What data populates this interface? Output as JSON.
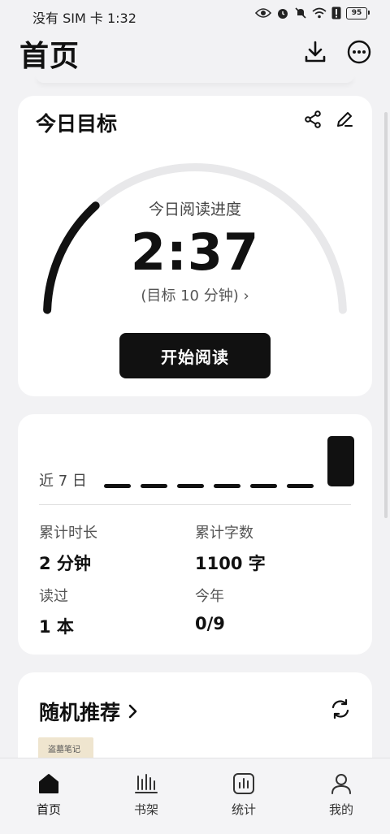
{
  "status_bar": {
    "left_text": "没有 SIM 卡 1:32",
    "battery": "95"
  },
  "header": {
    "title": "首页",
    "icons": [
      "download-icon",
      "more-icon"
    ]
  },
  "goal_card": {
    "title": "今日目标",
    "icons": [
      "share-icon",
      "edit-icon"
    ],
    "progress_label": "今日阅读进度",
    "time": "2:37",
    "target": "(目标 10 分钟) ›",
    "progress_fraction": 0.26,
    "start_button": "开始阅读"
  },
  "stats_card": {
    "recent_label": "近 7 日",
    "weekly_values": [
      0,
      0,
      0,
      0,
      0,
      0,
      1
    ],
    "stats": [
      {
        "label": "累计时长",
        "value": "2 分钟"
      },
      {
        "label": "累计字数",
        "value": "1100 字"
      },
      {
        "label": "读过",
        "value": "1 本"
      },
      {
        "label": "今年",
        "value": "0/9"
      }
    ]
  },
  "recommend_card": {
    "title": "随机推荐",
    "book_cover_text": "盗墓笔记"
  },
  "tab_bar": {
    "tabs": [
      {
        "label": "首页",
        "icon": "home-icon",
        "active": true
      },
      {
        "label": "书架",
        "icon": "bookshelf-icon",
        "active": false
      },
      {
        "label": "统计",
        "icon": "stats-icon",
        "active": false
      },
      {
        "label": "我的",
        "icon": "profile-icon",
        "active": false
      }
    ]
  },
  "colors": {
    "accent": "#111111",
    "background": "#f2f2f4",
    "track": "#e8e8ea"
  }
}
